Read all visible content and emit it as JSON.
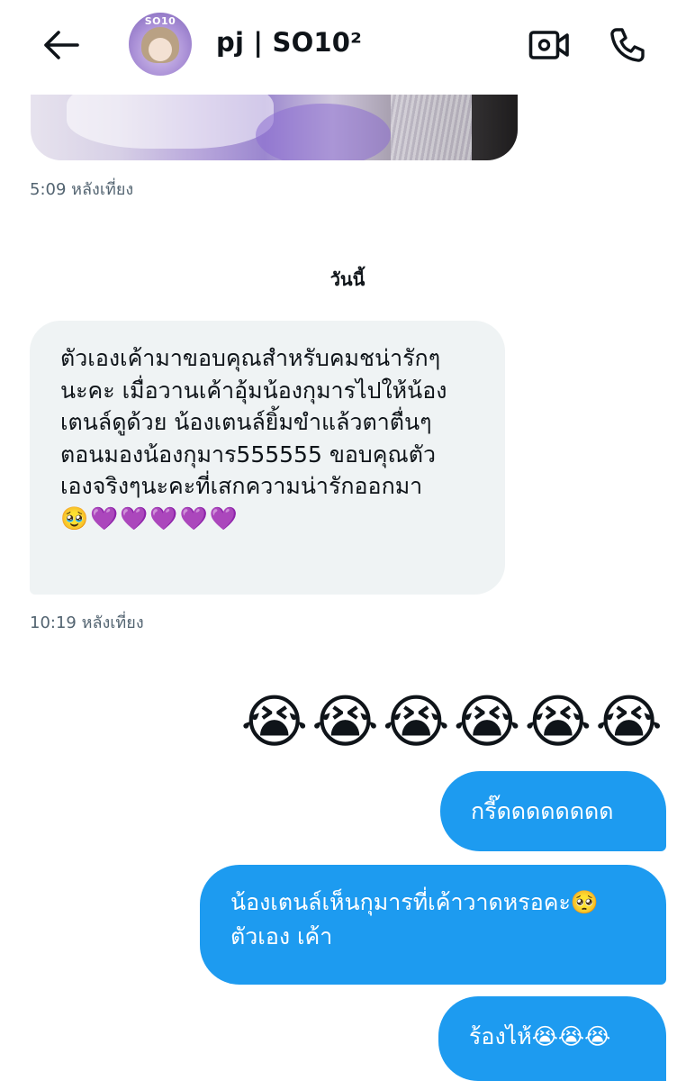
{
  "header": {
    "title": "pj | SO10²",
    "avatar_tag": "SO10",
    "icons": {
      "back": "arrow-left-icon",
      "video": "video-camera-icon",
      "call": "phone-icon"
    }
  },
  "messages": {
    "prev_timestamp": "5:09 หลังเที่ยง",
    "day_divider": "วันนี้",
    "received": {
      "text": "ตัวเองเค้ามาขอบคุณสำหรับคมชน่ารักๆ\nนะคะ เมื่อวานเค้าอุ้มน้องกุมารไปให้น้อง\nเตนล์ดูด้วย น้องเตนล์ยิ้มขำแล้วตาตื่นๆ\nตอนมองน้องกุมาร555555 ขอบคุณตัว\nเองจริงๆนะคะที่เสกความน่ารักออกมา",
      "emoji": "🥹💜💜💜💜💜",
      "timestamp": "10:19 หลังเที่ยง"
    },
    "sent_emoji_row": "😭😭😭😭😭😭",
    "sent": [
      {
        "text": "กรี๊ดดดดดดดด"
      },
      {
        "text": "น้องเตนล์เห็นกุมารที่เค้าวาดหรอคะ🥺\nตัวเอง เค้า"
      },
      {
        "text": "ร้องไห้😭😭😭"
      }
    ]
  },
  "colors": {
    "sent_bubble": "#1d9bf0",
    "received_bubble": "#eff3f4",
    "timestamp": "#536471",
    "text": "#0f1419"
  }
}
